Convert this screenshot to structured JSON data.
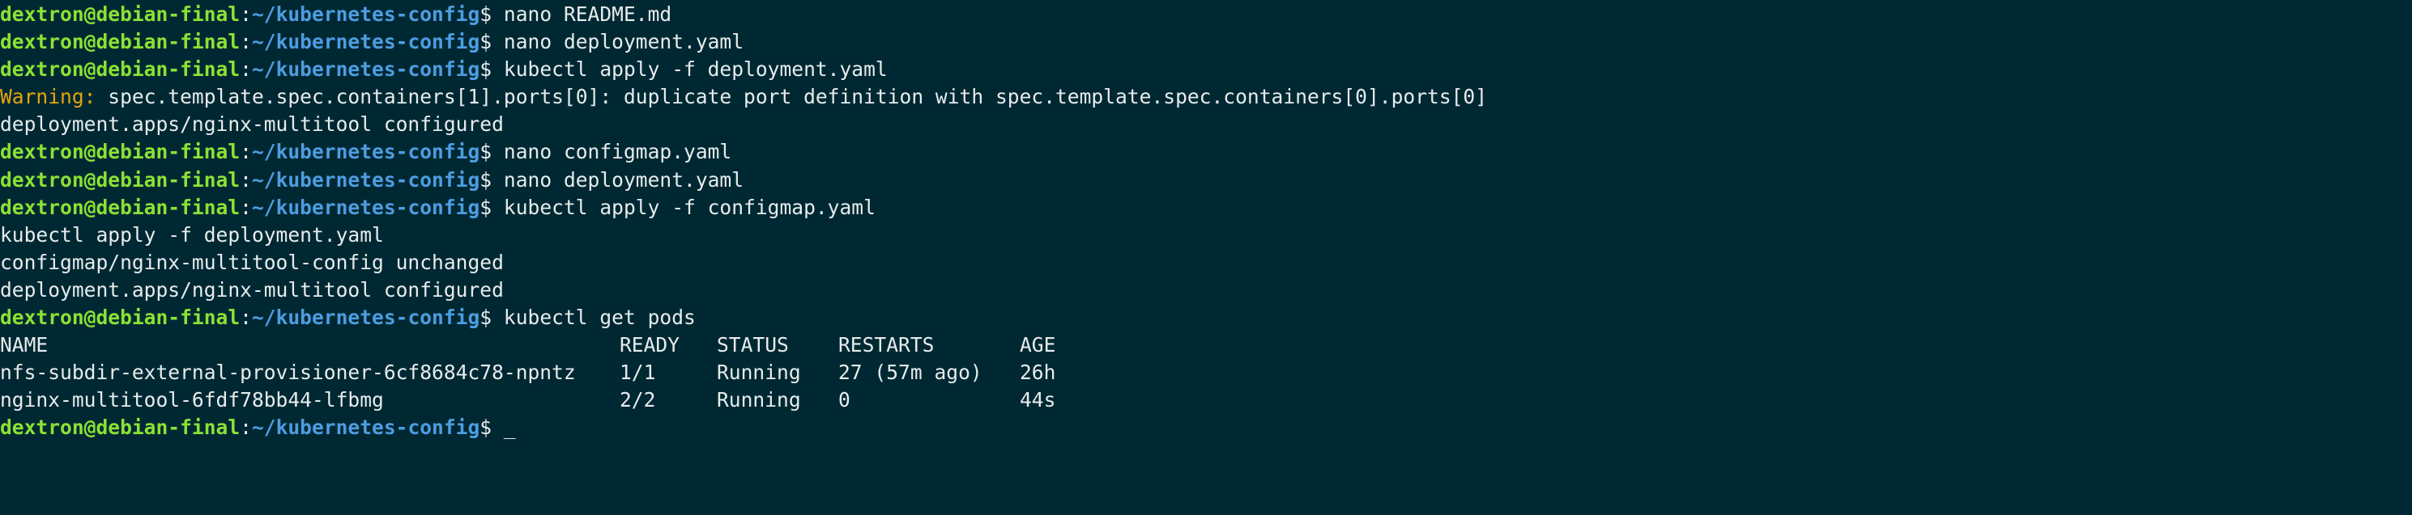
{
  "prompt": {
    "user_host": "dextron@debian-final",
    "colon": ":",
    "path": "~/kubernetes-config",
    "symbol": "$ "
  },
  "lines": [
    {
      "type": "prompt",
      "cmd": "nano README.md"
    },
    {
      "type": "prompt",
      "cmd": "nano deployment.yaml"
    },
    {
      "type": "prompt",
      "cmd": "kubectl apply -f deployment.yaml"
    },
    {
      "type": "warning",
      "label": "Warning:",
      "text": " spec.template.spec.containers[1].ports[0]: duplicate port definition with spec.template.spec.containers[0].ports[0]"
    },
    {
      "type": "output",
      "text": "deployment.apps/nginx-multitool configured"
    },
    {
      "type": "prompt",
      "cmd": "nano configmap.yaml"
    },
    {
      "type": "prompt",
      "cmd": "nano deployment.yaml"
    },
    {
      "type": "prompt",
      "cmd": "kubectl apply -f configmap.yaml"
    },
    {
      "type": "output",
      "text": "kubectl apply -f deployment.yaml"
    },
    {
      "type": "output",
      "text": "configmap/nginx-multitool-config unchanged"
    },
    {
      "type": "output",
      "text": "deployment.apps/nginx-multitool configured"
    },
    {
      "type": "prompt",
      "cmd": "kubectl get pods"
    },
    {
      "type": "row",
      "cells": [
        "NAME",
        "READY",
        "STATUS",
        "RESTARTS",
        "AGE"
      ]
    },
    {
      "type": "row",
      "cells": [
        "nfs-subdir-external-provisioner-6cf8684c78-npntz",
        "1/1",
        "Running",
        "27 (57m ago)",
        "26h"
      ]
    },
    {
      "type": "row",
      "cells": [
        "nginx-multitool-6fdf78bb44-lfbmg",
        "2/2",
        "Running",
        "0",
        "44s"
      ]
    },
    {
      "type": "prompt",
      "cmd": "",
      "cursor": "_"
    }
  ],
  "colors": {
    "background": "#002833",
    "user_host": "#8ae234",
    "path": "#4d9de0",
    "warning": "#e5a50a",
    "text": "#e6ecec"
  }
}
